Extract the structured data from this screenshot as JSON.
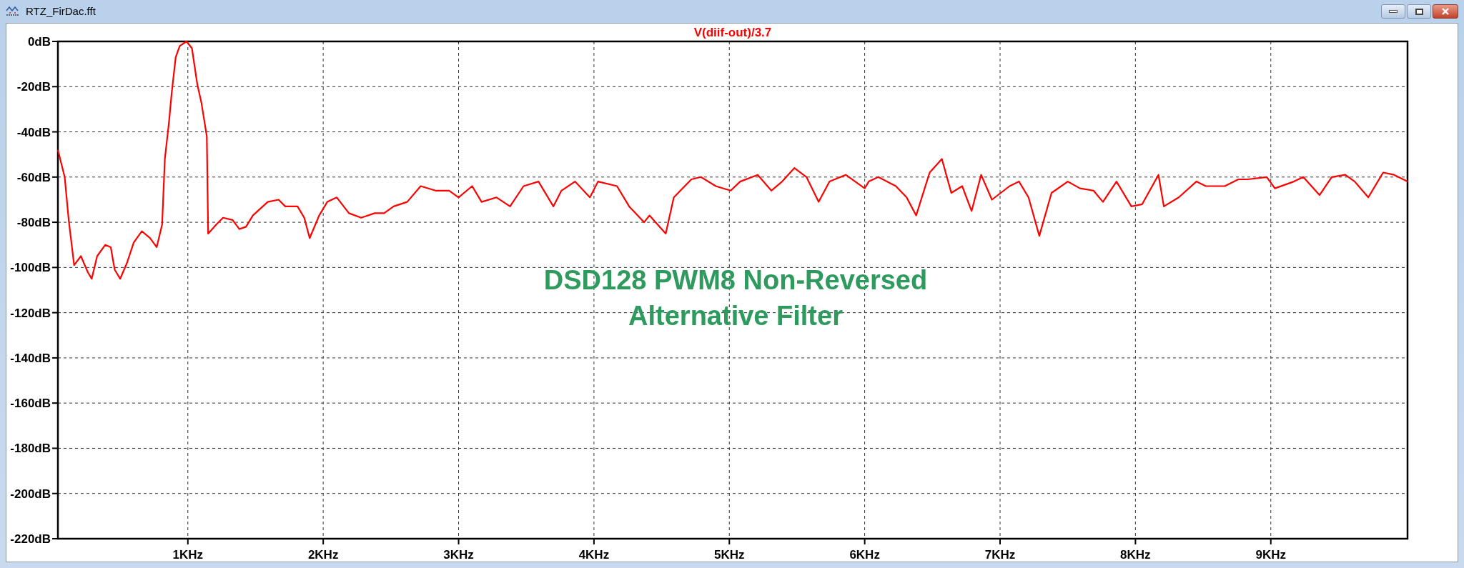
{
  "window": {
    "title": "RTZ_FirDac.fft"
  },
  "plot": {
    "chart_data": {
      "type": "line",
      "grid": true,
      "xlim": [
        0.04,
        10.01
      ],
      "ylim": [
        -220,
        0
      ],
      "xticks": [
        {
          "value": 1,
          "label": "1KHz"
        },
        {
          "value": 2,
          "label": "2KHz"
        },
        {
          "value": 3,
          "label": "3KHz"
        },
        {
          "value": 4,
          "label": "4KHz"
        },
        {
          "value": 5,
          "label": "5KHz"
        },
        {
          "value": 6,
          "label": "6KHz"
        },
        {
          "value": 7,
          "label": "7KHz"
        },
        {
          "value": 8,
          "label": "8KHz"
        },
        {
          "value": 9,
          "label": "9KHz"
        }
      ],
      "yticks": [
        {
          "value": 0,
          "label": "0dB"
        },
        {
          "value": -20,
          "label": "-20dB"
        },
        {
          "value": -40,
          "label": "-40dB"
        },
        {
          "value": -60,
          "label": "-60dB"
        },
        {
          "value": -80,
          "label": "-80dB"
        },
        {
          "value": -100,
          "label": "-100dB"
        },
        {
          "value": -120,
          "label": "-120dB"
        },
        {
          "value": -140,
          "label": "-140dB"
        },
        {
          "value": -160,
          "label": "-160dB"
        },
        {
          "value": -180,
          "label": "-180dB"
        },
        {
          "value": -200,
          "label": "-200dB"
        },
        {
          "value": -220,
          "label": "-220dB"
        }
      ],
      "x": [
        0.04,
        0.09,
        0.12,
        0.16,
        0.21,
        0.26,
        0.29,
        0.33,
        0.39,
        0.43,
        0.46,
        0.5,
        0.55,
        0.6,
        0.66,
        0.72,
        0.77,
        0.81,
        0.83,
        0.86,
        0.88,
        0.91,
        0.94,
        0.99,
        1.03,
        1.07,
        1.1,
        1.14,
        1.15,
        1.21,
        1.26,
        1.33,
        1.38,
        1.43,
        1.48,
        1.59,
        1.67,
        1.72,
        1.81,
        1.86,
        1.9,
        1.97,
        2.03,
        2.1,
        2.19,
        2.28,
        2.38,
        2.45,
        2.52,
        2.62,
        2.72,
        2.83,
        2.93,
        3.0,
        3.1,
        3.17,
        3.28,
        3.38,
        3.48,
        3.59,
        3.7,
        3.76,
        3.86,
        3.97,
        4.03,
        4.17,
        4.26,
        4.37,
        4.41,
        4.53,
        4.59,
        4.72,
        4.79,
        4.9,
        5.01,
        5.08,
        5.21,
        5.31,
        5.39,
        5.48,
        5.57,
        5.66,
        5.74,
        5.86,
        6.0,
        6.03,
        6.1,
        6.23,
        6.31,
        6.38,
        6.48,
        6.57,
        6.64,
        6.72,
        6.79,
        6.86,
        6.94,
        7.07,
        7.14,
        7.21,
        7.29,
        7.38,
        7.5,
        7.59,
        7.69,
        7.76,
        7.86,
        7.97,
        8.05,
        8.17,
        8.21,
        8.32,
        8.45,
        8.52,
        8.66,
        8.76,
        8.83,
        8.97,
        9.03,
        9.17,
        9.24,
        9.36,
        9.45,
        9.55,
        9.62,
        9.72,
        9.83,
        9.91,
        10.01
      ],
      "series": [
        {
          "name": "V(diif-out)/3.7",
          "color": "#ff0000",
          "values": [
            -48,
            -60,
            -79,
            -99,
            -95,
            -102,
            -105,
            -95,
            -90,
            -91,
            -101,
            -105,
            -98,
            -89,
            -84,
            -87,
            -91,
            -81,
            -52,
            -36,
            -23,
            -7,
            -2,
            0,
            -3,
            -19,
            -27,
            -42,
            -85,
            -81,
            -78,
            -79,
            -83,
            -82,
            -77,
            -71,
            -70,
            -73,
            -73,
            -78,
            -87,
            -77,
            -71,
            -69,
            -76,
            -78,
            -76,
            -76,
            -73,
            -71,
            -64,
            -66,
            -66,
            -69,
            -64,
            -71,
            -69,
            -73,
            -64,
            -62,
            -73,
            -66,
            -62,
            -69,
            -62,
            -64,
            -73,
            -80,
            -77,
            -85,
            -69,
            -61,
            -60,
            -64,
            -66,
            -62,
            -59,
            -66,
            -62,
            -56,
            -60,
            -71,
            -62,
            -59,
            -65,
            -62,
            -60,
            -64,
            -69,
            -77,
            -58,
            -52,
            -67,
            -64,
            -75,
            -59,
            -70,
            -64,
            -62,
            -69,
            -86,
            -67,
            -62,
            -65,
            -66,
            -71,
            -62,
            -73,
            -72,
            -59,
            -73,
            -69,
            -62,
            -64,
            -64,
            -61,
            -61,
            -60,
            -65,
            -62,
            -60,
            -68,
            -60,
            -59,
            -62,
            -69,
            -58,
            -59,
            -62
          ]
        }
      ],
      "annotations": [
        {
          "text": "DSD128 PWM8 Non-Reversed"
        },
        {
          "text": "Alternative Filter"
        }
      ]
    }
  }
}
